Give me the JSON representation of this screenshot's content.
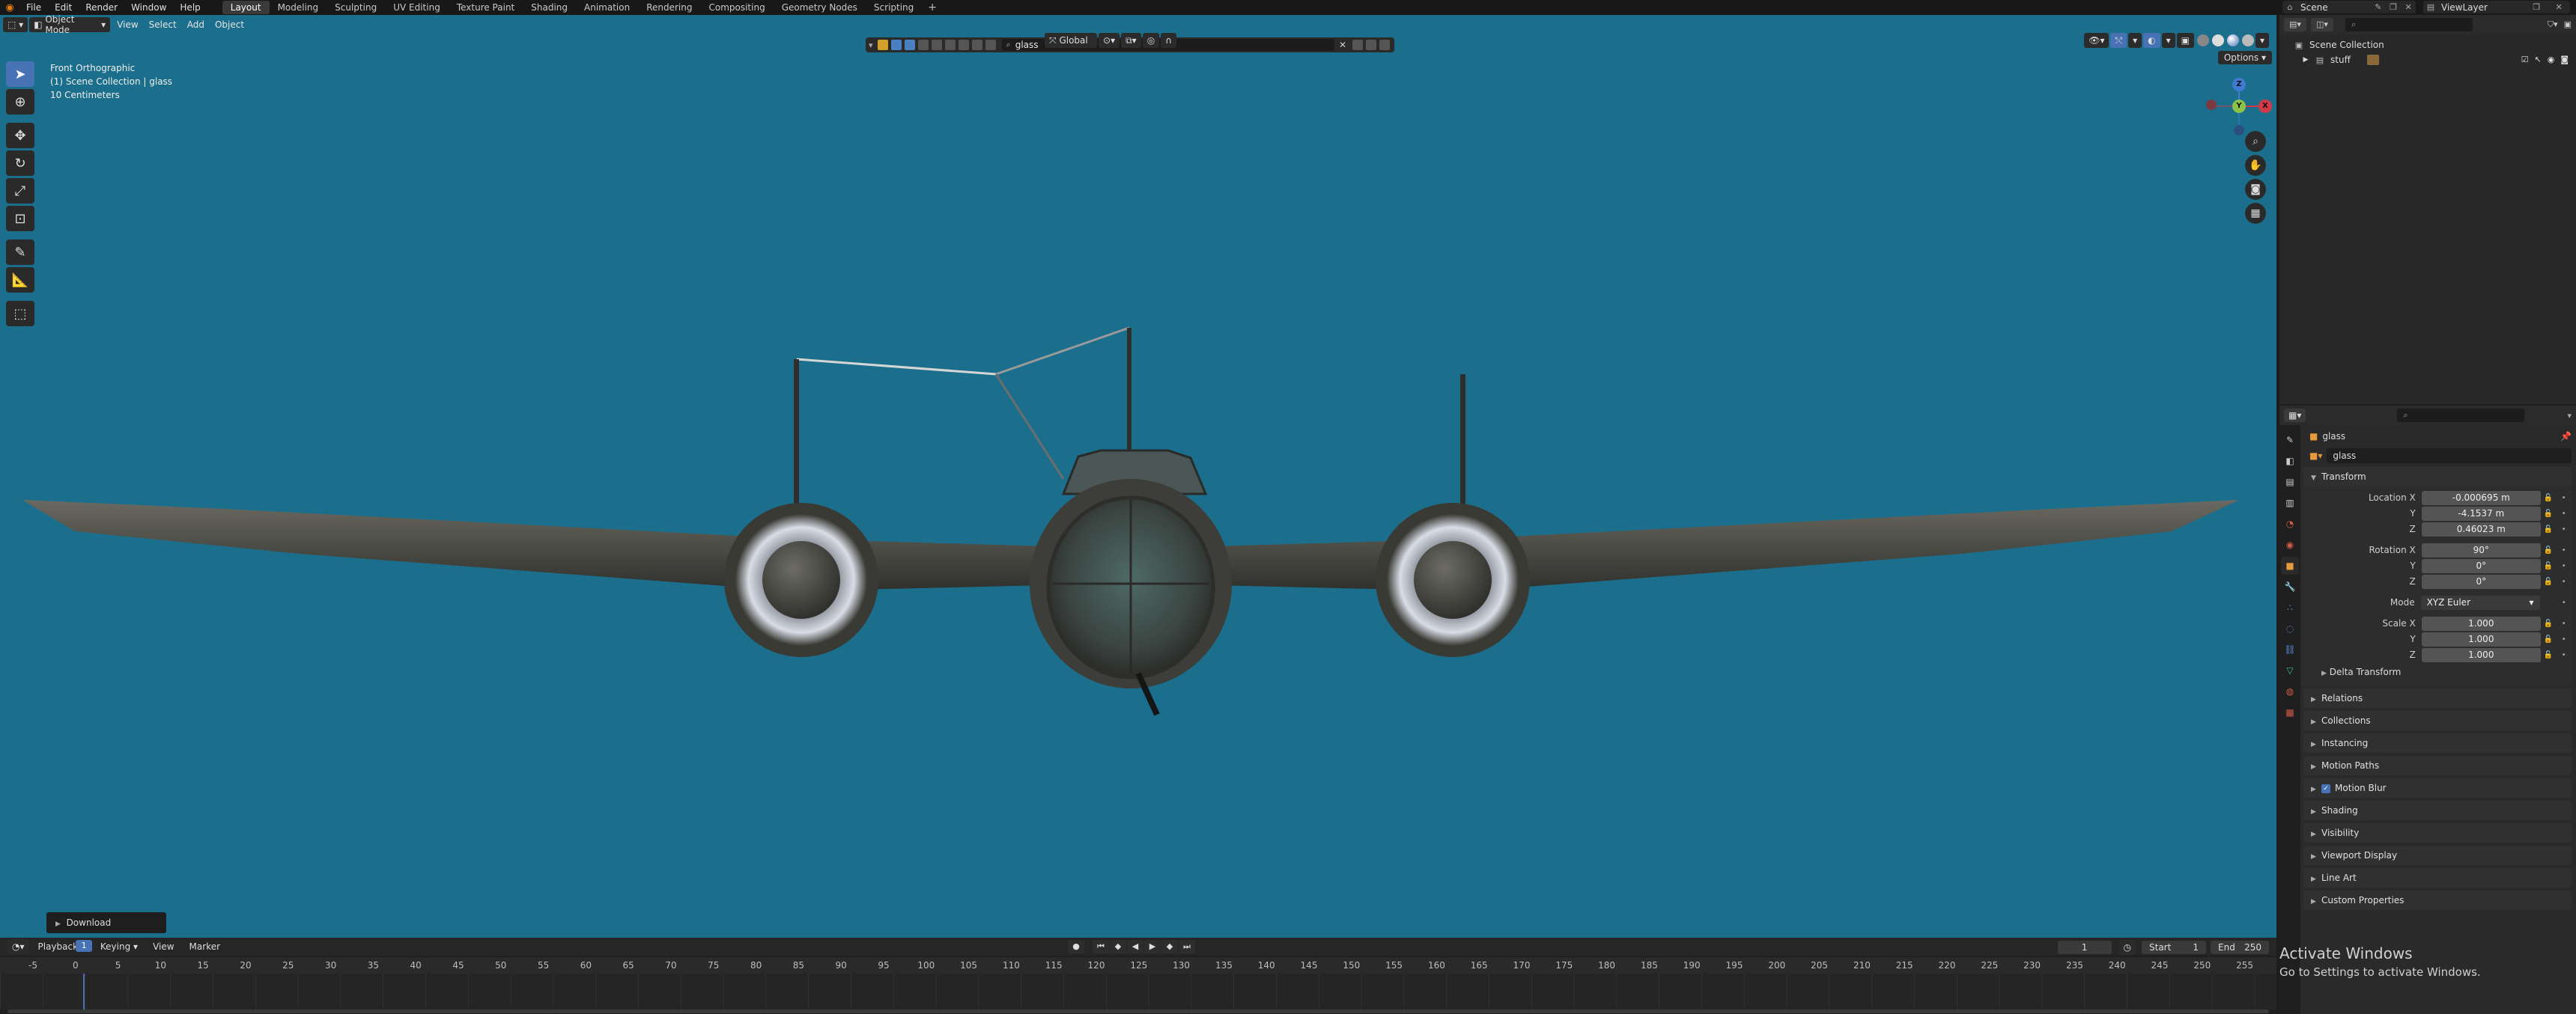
{
  "topbar": {
    "menus": [
      "File",
      "Edit",
      "Render",
      "Window",
      "Help"
    ],
    "workspaces": [
      "Layout",
      "Modeling",
      "Sculpting",
      "UV Editing",
      "Texture Paint",
      "Shading",
      "Animation",
      "Rendering",
      "Compositing",
      "Geometry Nodes",
      "Scripting"
    ],
    "active_workspace": "Layout",
    "add_tab": "+",
    "scene": "Scene",
    "view_layer": "ViewLayer"
  },
  "viewport": {
    "mode": "Object Mode",
    "menus": [
      "View",
      "Select",
      "Add",
      "Object"
    ],
    "orientation": "Global",
    "search_value": "glass",
    "options_label": "Options",
    "overlay_lines": [
      "Front Orthographic",
      "(1) Scene Collection | glass",
      "10 Centimeters"
    ],
    "download_label": "Download",
    "gizmo": {
      "z": "Z",
      "y": "Y",
      "x": "X"
    },
    "background_color": "#1b6f8c"
  },
  "timeline": {
    "menus": [
      "Playback",
      "Keying",
      "View",
      "Marker"
    ],
    "current_frame": "1",
    "start_label": "Start",
    "start_value": "1",
    "end_label": "End",
    "end_value": "250",
    "playhead_label": "1",
    "ticks": [
      "-5",
      "0",
      "5",
      "10",
      "15",
      "20",
      "25",
      "30",
      "35",
      "40",
      "45",
      "50",
      "55",
      "60",
      "65",
      "70",
      "75",
      "80",
      "85",
      "90",
      "95",
      "100",
      "105",
      "110",
      "115",
      "120",
      "125",
      "130",
      "135",
      "140",
      "145",
      "150",
      "155",
      "160",
      "165",
      "170",
      "175",
      "180",
      "185",
      "190",
      "195",
      "200",
      "205",
      "210",
      "215",
      "220",
      "225",
      "230",
      "235",
      "240",
      "245",
      "250",
      "255"
    ]
  },
  "outliner": {
    "root": "Scene Collection",
    "items": [
      {
        "name": "stuff"
      }
    ]
  },
  "properties": {
    "object_name": "glass",
    "data_name": "glass",
    "transform": {
      "title": "Transform",
      "location_label": "Location X",
      "location": [
        "-0.000695 m",
        "-4.1537 m",
        "0.46023 m"
      ],
      "rotation_label": "Rotation X",
      "rotation": [
        "90°",
        "0°",
        "0°"
      ],
      "mode_label": "Mode",
      "mode_value": "XYZ Euler",
      "scale_label": "Scale X",
      "scale": [
        "1.000",
        "1.000",
        "1.000"
      ],
      "y_label": "Y",
      "z_label": "Z",
      "delta": "Delta Transform"
    },
    "sections": [
      "Relations",
      "Collections",
      "Instancing",
      "Motion Paths",
      "Motion Blur",
      "Shading",
      "Visibility",
      "Viewport Display",
      "Line Art",
      "Custom Properties"
    ]
  },
  "watermark": {
    "title": "Activate Windows",
    "subtitle": "Go to Settings to activate Windows."
  }
}
